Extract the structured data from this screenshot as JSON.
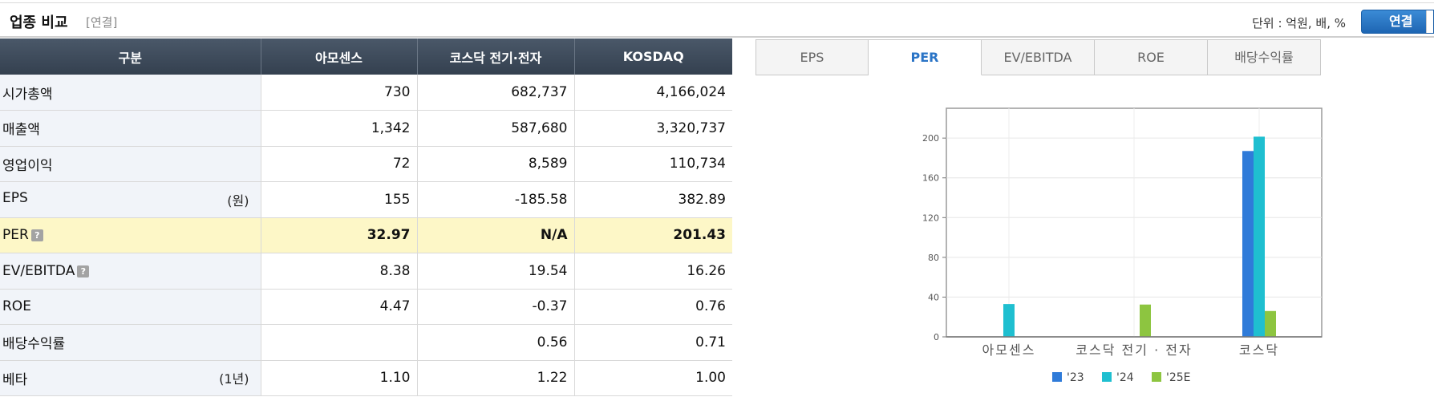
{
  "header": {
    "title": "업종 비교",
    "subtitle": "[연결]",
    "unit_text": "단위 : 억원, 배, %",
    "consolidated_button": "연결"
  },
  "table": {
    "headers": [
      "구분",
      "아모센스",
      "코스닥 전기·전자",
      "KOSDAQ"
    ],
    "rows": [
      {
        "label": "시가총액",
        "unit": "",
        "values": [
          "730",
          "682,737",
          "4,166,024"
        ]
      },
      {
        "label": "매출액",
        "unit": "",
        "values": [
          "1,342",
          "587,680",
          "3,320,737"
        ]
      },
      {
        "label": "영업이익",
        "unit": "",
        "values": [
          "72",
          "8,589",
          "110,734"
        ]
      },
      {
        "label": "EPS",
        "unit": "(원)",
        "values": [
          "155",
          "-185.58",
          "382.89"
        ]
      },
      {
        "label": "PER",
        "unit": "",
        "values": [
          "32.97",
          "N/A",
          "201.43"
        ]
      },
      {
        "label": "EV/EBITDA",
        "unit": "",
        "values": [
          "8.38",
          "19.54",
          "16.26"
        ]
      },
      {
        "label": "ROE",
        "unit": "",
        "values": [
          "4.47",
          "-0.37",
          "0.76"
        ]
      },
      {
        "label": "배당수익률",
        "unit": "",
        "values": [
          "",
          "0.56",
          "0.71"
        ]
      },
      {
        "label": "베타",
        "unit": "(1년)",
        "values": [
          "1.10",
          "1.22",
          "1.00"
        ]
      }
    ],
    "help_icon_text": "?"
  },
  "tabs": [
    {
      "label": "EPS"
    },
    {
      "label": "PER"
    },
    {
      "label": "EV/EBITDA"
    },
    {
      "label": "ROE"
    },
    {
      "label": "배당수익률"
    }
  ],
  "colors": {
    "series_23": "#2f7bd9",
    "series_24": "#1fbfd0",
    "series_25e": "#8dc540",
    "negative": "#d11616",
    "active_tab": "#2a74c6"
  },
  "chart_data": {
    "type": "bar",
    "categories": [
      "아모센스",
      "코스닥 전기 · 전자",
      "코스닥"
    ],
    "series": [
      {
        "name": "'23",
        "values": [
          null,
          null,
          187
        ]
      },
      {
        "name": "'24",
        "values": [
          33,
          null,
          201.43
        ]
      },
      {
        "name": "'25E",
        "values": [
          null,
          32.5,
          26
        ]
      }
    ],
    "ylim": [
      0,
      230
    ],
    "yticks": [
      0,
      40,
      80,
      120,
      160,
      200
    ],
    "grid": true,
    "legend": "bottom"
  }
}
